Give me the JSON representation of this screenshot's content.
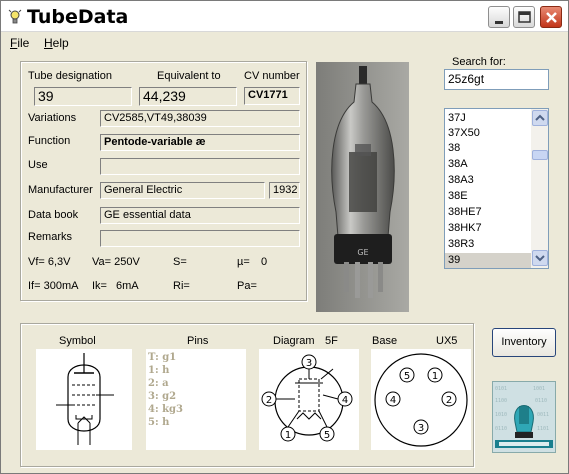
{
  "window": {
    "title": "TubeData"
  },
  "menu": {
    "file": "File",
    "help": "Help",
    "file_accel": "F",
    "file_rest": "ile",
    "help_accel": "H",
    "help_rest": "elp"
  },
  "tube": {
    "designation_label": "Tube designation",
    "designation": "39",
    "equivalent_label": "Equivalent to",
    "equivalent": "44,239",
    "cv_label": "CV number",
    "cv": "CV1771",
    "variations_label": "Variations",
    "variations": "CV2585,VT49,38039",
    "function_label": "Function",
    "function": "Pentode-variable æ",
    "use_label": "Use",
    "use": "",
    "manufacturer_label": "Manufacturer",
    "manufacturer": "General Electric",
    "year": "1932",
    "databook_label": "Data book",
    "databook": "GE essential data",
    "remarks_label": "Remarks",
    "remarks": ""
  },
  "params": {
    "vf": "Vf= 6,3V",
    "va": "Va= 250V",
    "s": "S=",
    "mu": "µ=",
    "mu_val": "0",
    "if": "If= 300mA",
    "ik": "Ik=",
    "ik_val": "6mA",
    "ri": "Ri=",
    "pa": "Pa="
  },
  "search": {
    "label": "Search for:",
    "value": "25z6gt",
    "list": [
      "37J",
      "37X50",
      "38",
      "38A",
      "38A3",
      "38E",
      "38HE7",
      "38HK7",
      "38R3",
      "39"
    ],
    "selected": "39"
  },
  "bottom": {
    "symbol_label": "Symbol",
    "pins_label": "Pins",
    "diagram_label": "Diagram",
    "diagram_code": "5F",
    "base_label": "Base",
    "base_code": "UX5",
    "pins": [
      "T: g1",
      "1: h",
      "2: a",
      "3: g2",
      "4: kg3",
      "5: h"
    ],
    "diagram_numbers": [
      "1",
      "2",
      "3",
      "4",
      "5"
    ],
    "base_numbers": [
      "1",
      "2",
      "3",
      "4",
      "5"
    ]
  },
  "buttons": {
    "inventory": "Inventory"
  },
  "icons": {
    "app": "lightbulb-icon",
    "minimize": "minimize-icon",
    "maximize": "maximize-icon",
    "close": "close-icon",
    "scroll_up": "scroll-up-arrow-icon",
    "scroll_down": "scroll-down-arrow-icon"
  },
  "colors": {
    "face": "#ECE9D8",
    "close_button": "#c2351a",
    "selected_row": "#d5d2ca"
  }
}
